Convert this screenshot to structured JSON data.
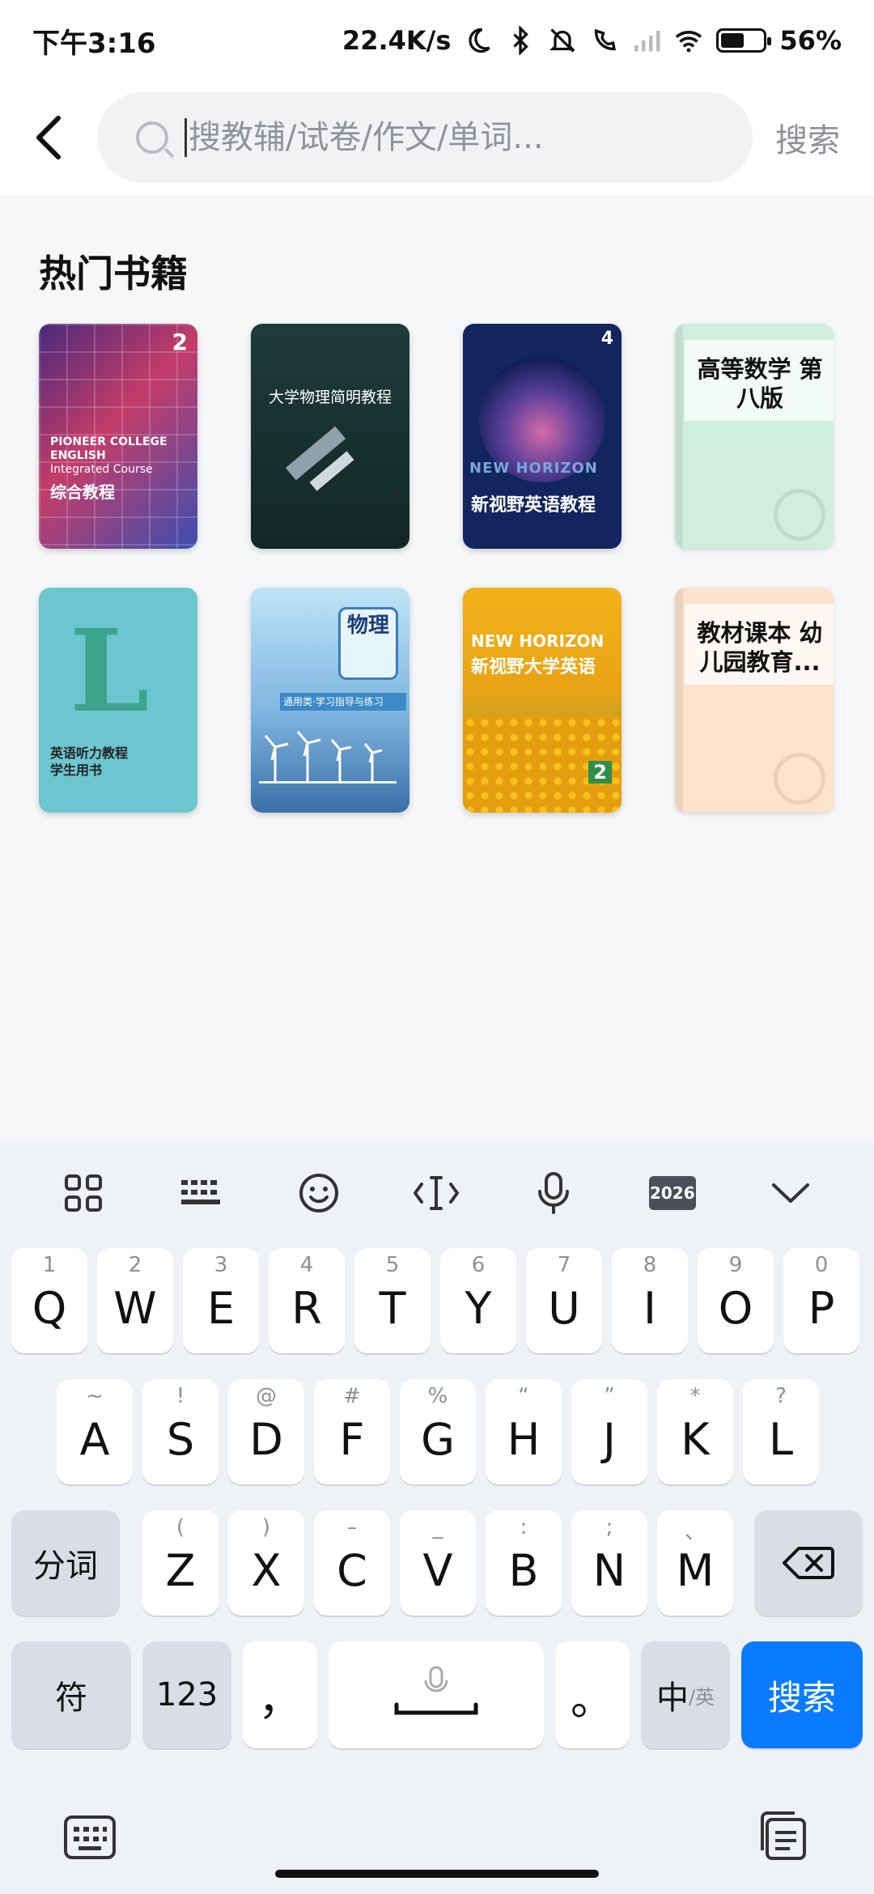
{
  "status_bar": {
    "time": "下午3:16",
    "network_speed": "22.4K/s",
    "battery_percent": "56%",
    "battery_level": 0.56
  },
  "header": {
    "search_placeholder": "搜教辅/试卷/作文/单词...",
    "search_button": "搜索"
  },
  "hot_books": {
    "title": "热门书籍",
    "books": [
      {
        "cover_lines": [
          "PIONEER COLLEGE",
          "ENGLISH",
          "Integrated Course"
        ],
        "cover_title": "综合教程",
        "badge": "2"
      },
      {
        "cover_title": "大学物理简明教程"
      },
      {
        "cover_lines": [
          "NEW HORIZON"
        ],
        "cover_title": "新视野英语教程",
        "badge": "4"
      },
      {
        "cover_title": "高等数学 第八版"
      },
      {
        "cover_lines": [
          "L"
        ],
        "cover_title": "英语听力教程",
        "cover_subtitle": "学生用书"
      },
      {
        "cover_title": "物理",
        "cover_subtitle": "通用类·学习指导与练习"
      },
      {
        "cover_lines": [
          "NEW HORIZON"
        ],
        "cover_title": "新视野大学英语",
        "badge": "2"
      },
      {
        "cover_title": "教材课本 幼儿园教育..."
      }
    ]
  },
  "keyboard": {
    "toolbar": [
      "apps-icon",
      "keyboard-layout-icon",
      "emoji-icon",
      "cursor-icon",
      "mic-icon",
      "2026",
      "collapse-icon"
    ],
    "row1": [
      {
        "k": "Q",
        "h": "1"
      },
      {
        "k": "W",
        "h": "2"
      },
      {
        "k": "E",
        "h": "3"
      },
      {
        "k": "R",
        "h": "4"
      },
      {
        "k": "T",
        "h": "5"
      },
      {
        "k": "Y",
        "h": "6"
      },
      {
        "k": "U",
        "h": "7"
      },
      {
        "k": "I",
        "h": "8"
      },
      {
        "k": "O",
        "h": "9"
      },
      {
        "k": "P",
        "h": "0"
      }
    ],
    "row2": [
      {
        "k": "A",
        "h": "~"
      },
      {
        "k": "S",
        "h": "!"
      },
      {
        "k": "D",
        "h": "@"
      },
      {
        "k": "F",
        "h": "#"
      },
      {
        "k": "G",
        "h": "%"
      },
      {
        "k": "H",
        "h": "“"
      },
      {
        "k": "J",
        "h": "”"
      },
      {
        "k": "K",
        "h": "*"
      },
      {
        "k": "L",
        "h": "?"
      }
    ],
    "row3": [
      {
        "k": "Z",
        "h": "("
      },
      {
        "k": "X",
        "h": ")"
      },
      {
        "k": "C",
        "h": "–"
      },
      {
        "k": "V",
        "h": "_"
      },
      {
        "k": "B",
        "h": ":"
      },
      {
        "k": "N",
        "h": ";"
      },
      {
        "k": "M",
        "h": "、"
      }
    ],
    "split_key": "分词",
    "symbol_key": "符",
    "num_key": "123",
    "comma_key": "，",
    "period_key": "。",
    "lang_key_main": "中",
    "lang_key_sub": "/英",
    "enter_key": "搜索"
  }
}
